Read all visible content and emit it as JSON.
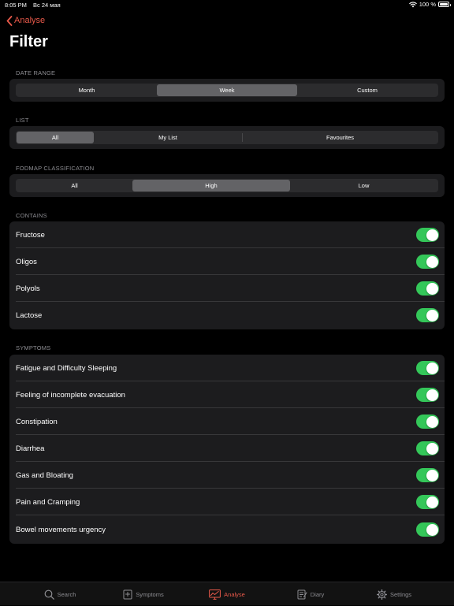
{
  "status_bar": {
    "time": "8:05 PM",
    "date": "Вс 24 мая",
    "battery": "100 %"
  },
  "nav": {
    "back_label": "Analyse",
    "title": "Filter"
  },
  "date_range": {
    "header": "DATE RANGE",
    "segments": [
      "Month",
      "Week",
      "Custom"
    ],
    "selected": "Week"
  },
  "list": {
    "header": "LIST",
    "segments": [
      "All",
      "My List",
      "Favourites"
    ],
    "selected": "All"
  },
  "fodmap": {
    "header": "FODMAP CLASSIFICATION",
    "segments": [
      "All",
      "High",
      "Low"
    ],
    "selected": "High"
  },
  "contains": {
    "header": "CONTAINS",
    "items": [
      {
        "label": "Fructose",
        "on": true
      },
      {
        "label": "Oligos",
        "on": true
      },
      {
        "label": "Polyols",
        "on": true
      },
      {
        "label": "Lactose",
        "on": true
      }
    ]
  },
  "symptoms": {
    "header": "SYMPTOMS",
    "items": [
      {
        "label": "Fatigue and Difficulty Sleeping",
        "on": true
      },
      {
        "label": "Feeling of incomplete evacuation",
        "on": true
      },
      {
        "label": "Constipation",
        "on": true
      },
      {
        "label": "Diarrhea",
        "on": true
      },
      {
        "label": "Gas and Bloating",
        "on": true
      },
      {
        "label": "Pain and Cramping",
        "on": true
      },
      {
        "label": "Bowel movements urgency",
        "on": true
      }
    ]
  },
  "tab_bar": {
    "tabs": [
      {
        "label": "Search",
        "icon": "search-icon"
      },
      {
        "label": "Symptoms",
        "icon": "symptoms-icon"
      },
      {
        "label": "Analyse",
        "icon": "analyse-icon"
      },
      {
        "label": "Diary",
        "icon": "diary-icon"
      },
      {
        "label": "Settings",
        "icon": "gear-icon"
      }
    ],
    "active": "Analyse"
  },
  "colors": {
    "accent": "#e8594a",
    "toggle_on": "#34c759",
    "background": "#000000",
    "card": "#1c1c1e",
    "secondary_text": "#8d8d92"
  }
}
